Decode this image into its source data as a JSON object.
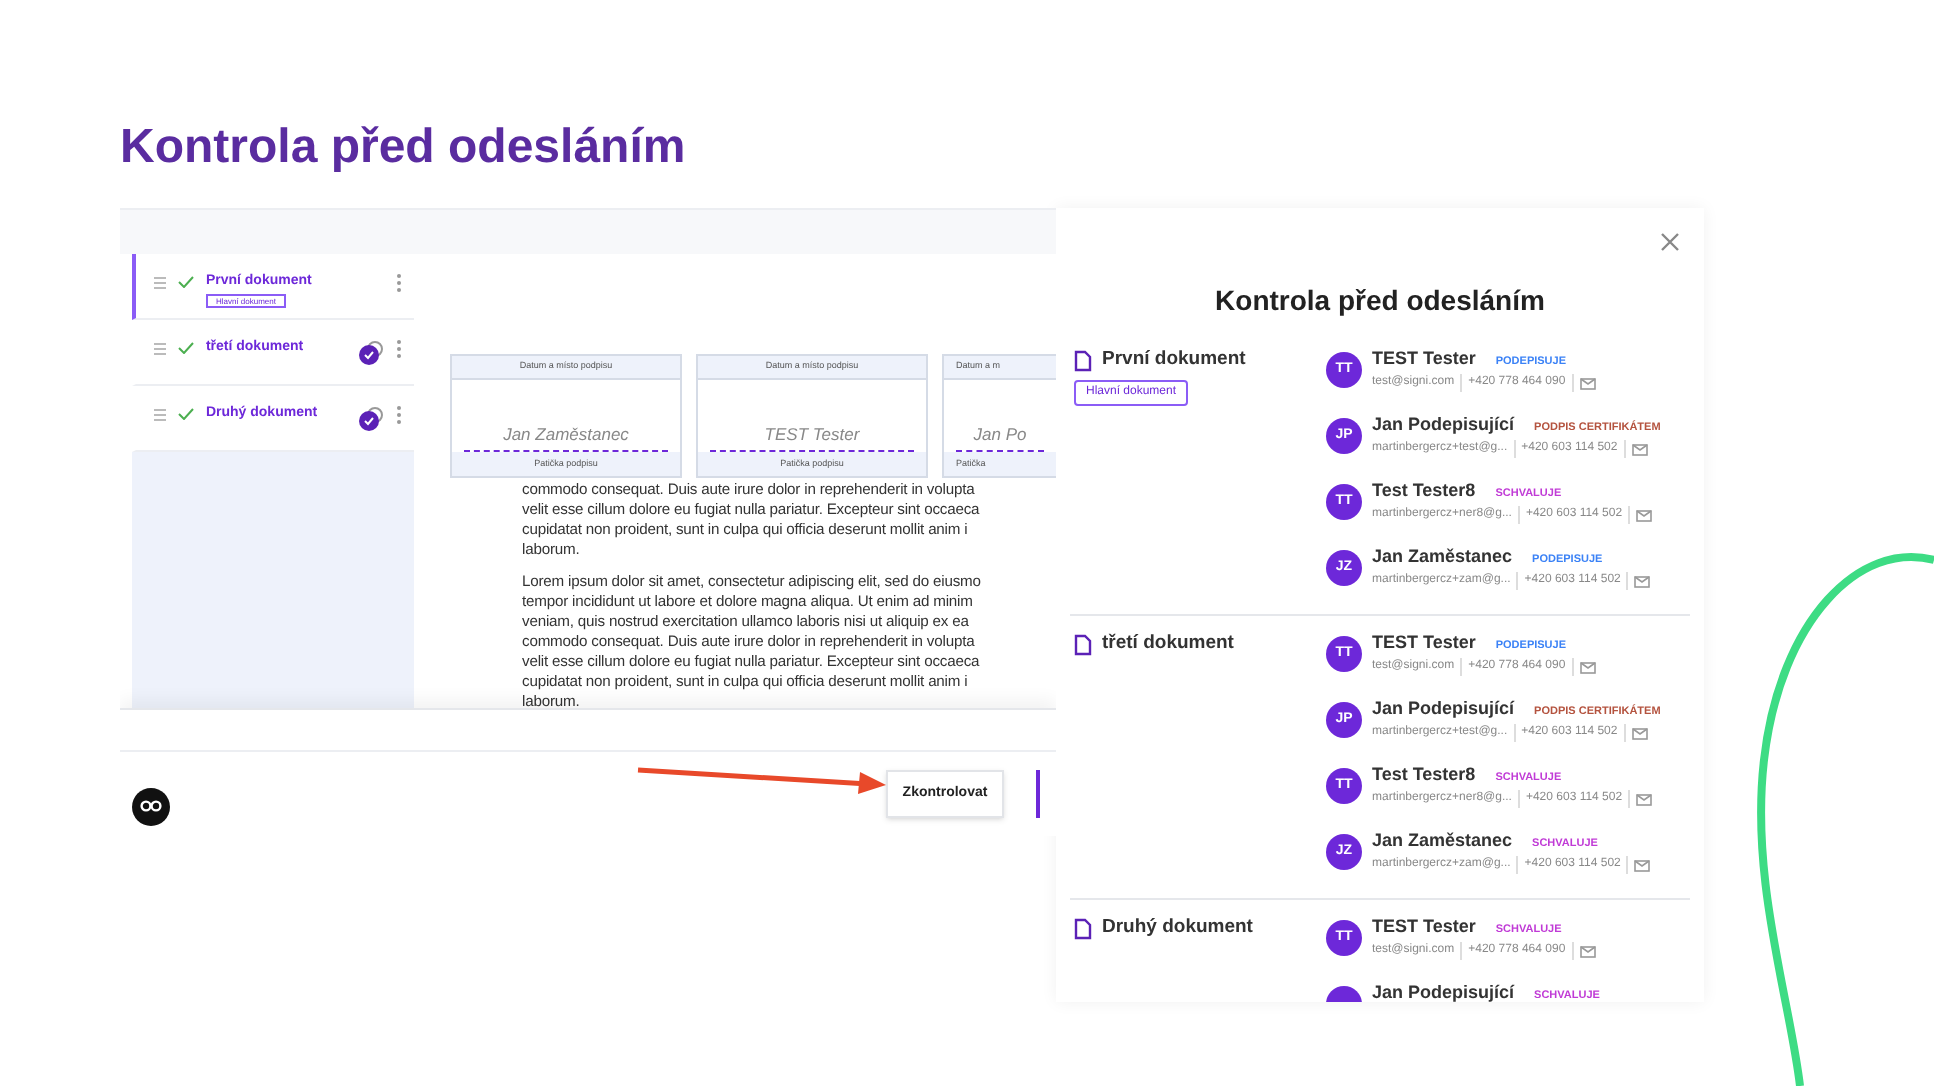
{
  "slide_title": "Kontrola před odesláním",
  "editor": {
    "documents": [
      {
        "title": "První dokument",
        "badge": "Hlavní dokument",
        "selected": true,
        "checked": true,
        "sealed": false
      },
      {
        "title": "třetí dokument",
        "selected": false,
        "checked": true,
        "sealed": true
      },
      {
        "title": "Druhý dokument",
        "selected": false,
        "checked": true,
        "sealed": true
      }
    ],
    "signature_fields": [
      {
        "header": "Datum a místo podpisu",
        "name": "Jan Zaměstanec",
        "footer": "Patička podpisu"
      },
      {
        "header": "Datum a místo podpisu",
        "name": "TEST Tester",
        "footer": "Patička podpisu"
      },
      {
        "header": "Datum a m",
        "name": "Jan Po",
        "footer": "Patička"
      }
    ],
    "document_text": [
      [
        "commodo consequat. Duis aute irure dolor in reprehenderit in volupta",
        "velit esse cillum dolore eu fugiat nulla pariatur. Excepteur sint occaeca",
        "cupidatat non proident, sunt in culpa qui officia deserunt mollit anim i",
        "laborum."
      ],
      [
        "Lorem ipsum dolor sit amet, consectetur adipiscing elit, sed do eiusmo",
        "tempor incididunt ut labore et dolore magna aliqua. Ut enim ad minim",
        "veniam, quis nostrud exercitation ullamco laboris nisi ut aliquip ex ea",
        "commodo consequat. Duis aute irure dolor in reprehenderit in volupta",
        "velit esse cillum dolore eu fugiat nulla pariatur. Excepteur sint occaeca",
        "cupidatat non proident, sunt in culpa qui officia deserunt mollit anim i",
        "laborum."
      ]
    ],
    "check_button": "Zkontrolovat"
  },
  "dialog": {
    "title": "Kontrola před odesláním",
    "documents": [
      {
        "title": "První dokument",
        "badge": "Hlavní dokument",
        "signers": [
          {
            "initials": "TT",
            "name": "TEST Tester",
            "role": "PODEPISUJE",
            "color": "#3b82f6",
            "email": "test@signi.com",
            "phone": "+420 778 464 090"
          },
          {
            "initials": "JP",
            "name": "Jan Podepisující",
            "role": "PODPIS CERTIFIKÁTEM",
            "color": "#b4533f",
            "email": "martinbergercz+test@g...",
            "phone": "+420 603 114 502"
          },
          {
            "initials": "TT",
            "name": "Test Tester8",
            "role": "SCHVALUJE",
            "color": "#c03bd6",
            "email": "martinbergercz+ner8@g...",
            "phone": "+420 603 114 502"
          },
          {
            "initials": "JZ",
            "name": "Jan Zaměstanec",
            "role": "PODEPISUJE",
            "color": "#3b82f6",
            "email": "martinbergercz+zam@g...",
            "phone": "+420 603 114 502"
          }
        ]
      },
      {
        "title": "třetí dokument",
        "signers": [
          {
            "initials": "TT",
            "name": "TEST Tester",
            "role": "PODEPISUJE",
            "color": "#3b82f6",
            "email": "test@signi.com",
            "phone": "+420 778 464 090"
          },
          {
            "initials": "JP",
            "name": "Jan Podepisující",
            "role": "PODPIS CERTIFIKÁTEM",
            "color": "#b4533f",
            "email": "martinbergercz+test@g...",
            "phone": "+420 603 114 502"
          },
          {
            "initials": "TT",
            "name": "Test Tester8",
            "role": "SCHVALUJE",
            "color": "#c03bd6",
            "email": "martinbergercz+ner8@g...",
            "phone": "+420 603 114 502"
          },
          {
            "initials": "JZ",
            "name": "Jan Zaměstanec",
            "role": "SCHVALUJE",
            "color": "#c03bd6",
            "email": "martinbergercz+zam@g...",
            "phone": "+420 603 114 502"
          }
        ]
      },
      {
        "title": "Druhý dokument",
        "signers": [
          {
            "initials": "TT",
            "name": "TEST Tester",
            "role": "SCHVALUJE",
            "color": "#c03bd6",
            "email": "test@signi.com",
            "phone": "+420 778 464 090"
          },
          {
            "name": "Jan Podepisující",
            "role": "SCHVALUJE",
            "color": "#c03bd6"
          }
        ]
      }
    ]
  }
}
